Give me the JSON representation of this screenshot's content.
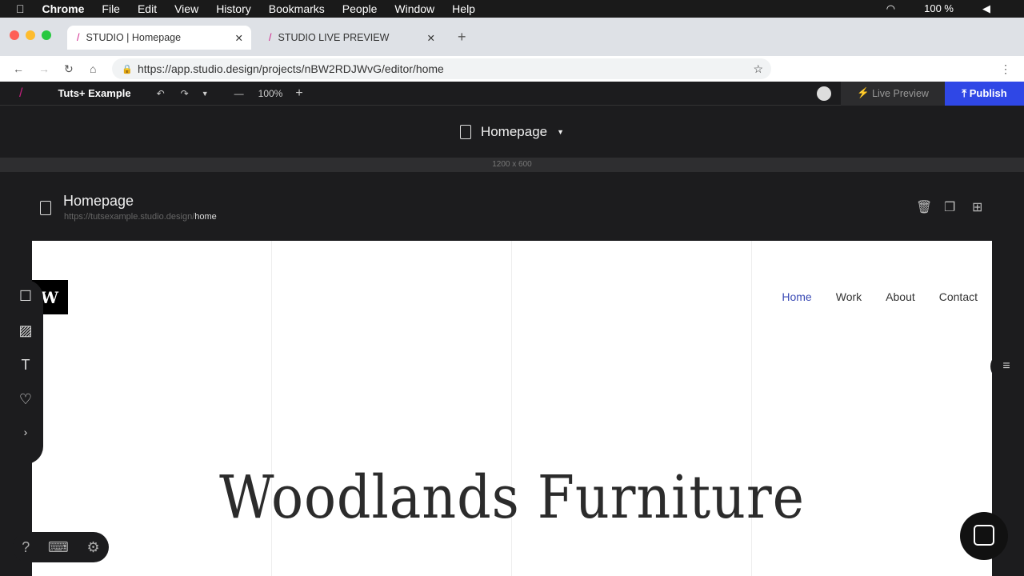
{
  "menubar": {
    "app": "Chrome",
    "items": [
      "File",
      "Edit",
      "View",
      "History",
      "Bookmarks",
      "People",
      "Window",
      "Help"
    ],
    "battery": "100 %"
  },
  "tabs": [
    {
      "title": "STUDIO | Homepage"
    },
    {
      "title": "STUDIO LIVE PREVIEW"
    }
  ],
  "address": {
    "url": "https://app.studio.design/projects/nBW2RDJWvG/editor/home"
  },
  "toolbar": {
    "project": "Tuts+ Example",
    "zoom": "100%",
    "live_preview": "Live Preview",
    "publish": "Publish"
  },
  "page": {
    "name": "Homepage",
    "size": "1200 x 600",
    "url_base": "https://tutsexample.studio.design/",
    "url_slug": "home"
  },
  "site": {
    "logo": "W",
    "nav": [
      "Home",
      "Work",
      "About",
      "Contact"
    ],
    "hero": "Woodlands Furniture"
  },
  "colors": {
    "publish": "#2f47e6",
    "nav_active": "#3b4bb5"
  }
}
